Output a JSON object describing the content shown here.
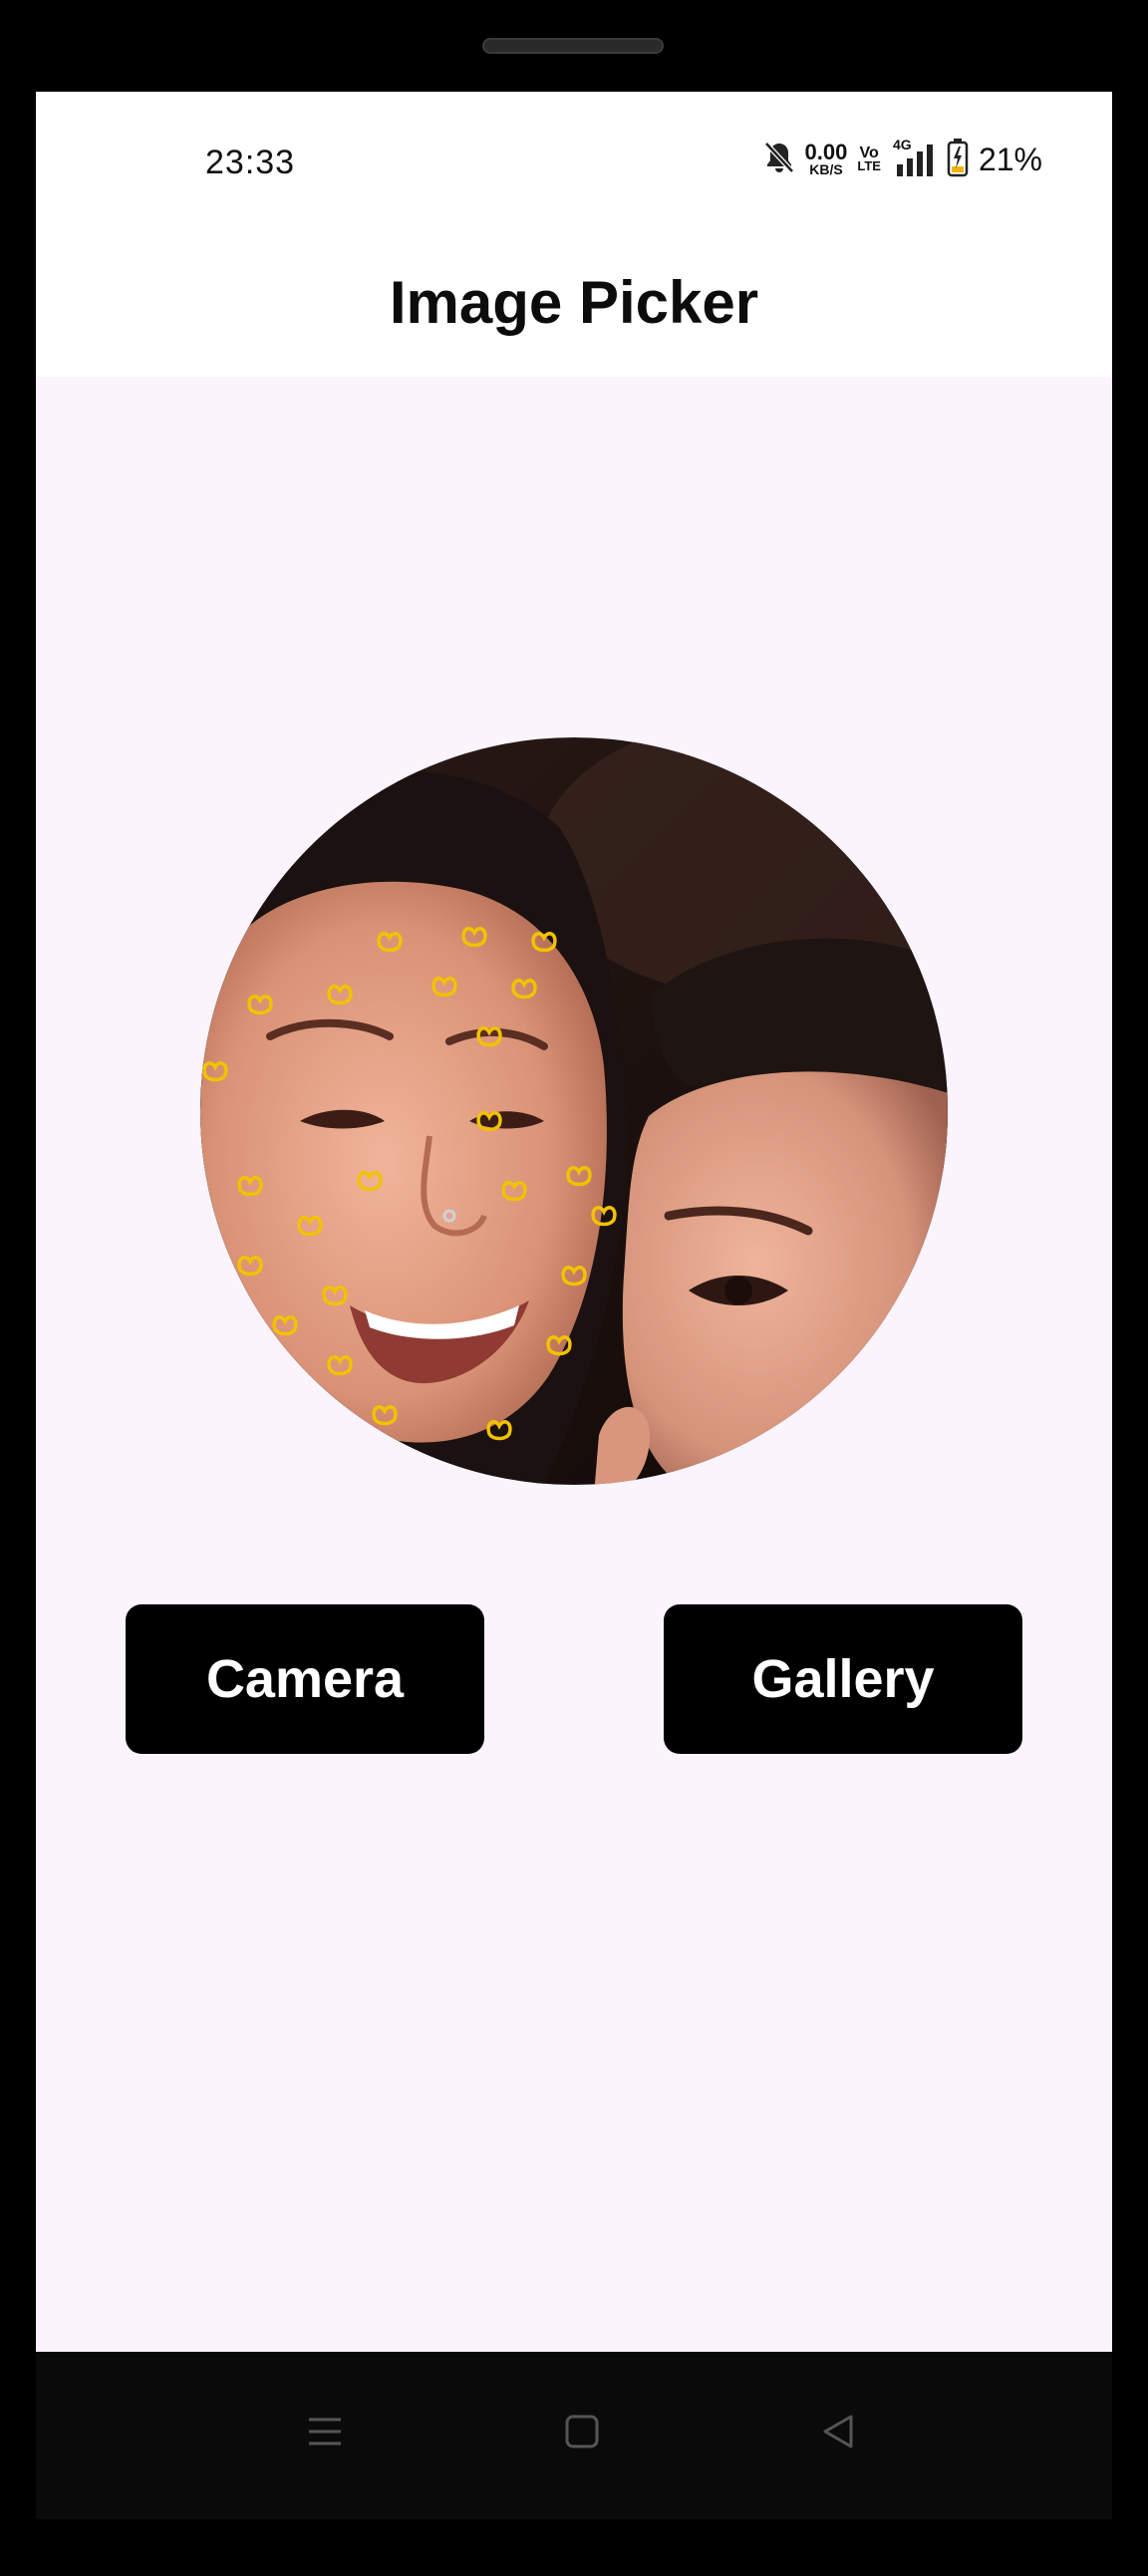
{
  "status_bar": {
    "time": "23:33",
    "net_speed_value": "0.00",
    "net_speed_unit": "KB/S",
    "volte_top": "Vo",
    "volte_bottom": "LTE",
    "network_type": "4G",
    "battery_percent": "21%",
    "icons": [
      "bell-muted-icon",
      "signal-icon",
      "battery-charging-icon"
    ]
  },
  "app_bar": {
    "title": "Image Picker"
  },
  "main": {
    "camera_label": "Camera",
    "gallery_label": "Gallery"
  },
  "nav_bar": {
    "icons": [
      "menu-icon",
      "home-icon",
      "back-icon"
    ]
  },
  "colors": {
    "background": "#fbf4fd",
    "app_bar": "#ffffff",
    "button_bg": "#000000",
    "button_text": "#ffffff",
    "sticker_accent": "#f2c200"
  }
}
